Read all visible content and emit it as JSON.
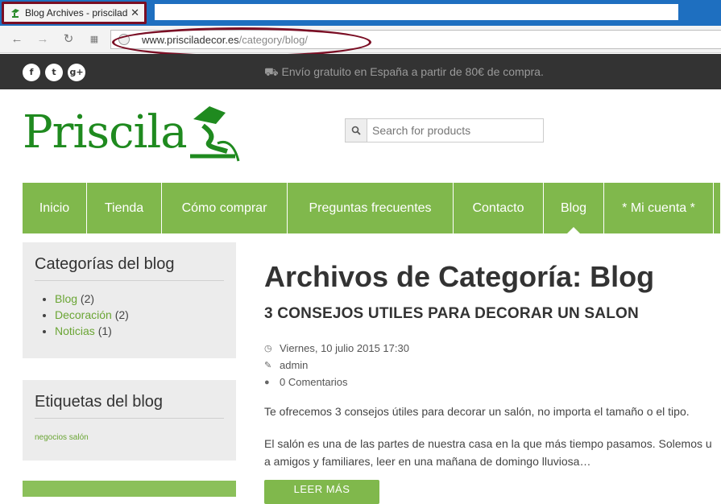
{
  "browser": {
    "tab_title": "Blog Archives - prisciladi",
    "close_glyph": "✕",
    "url_domain": "www.prisciladecor.es",
    "url_path": "/category/blog/"
  },
  "topbar": {
    "social": [
      "f",
      "t",
      "g+"
    ],
    "shipping": "Envío gratuito en España a partir de 80€ de compra."
  },
  "header": {
    "logo": "Priscila",
    "search_placeholder": "Search for products"
  },
  "menu": [
    {
      "label": "Inicio",
      "width": 80
    },
    {
      "label": "Tienda",
      "width": 93
    },
    {
      "label": "Cómo comprar",
      "width": 156
    },
    {
      "label": "Preguntas frecuentes",
      "width": 206
    },
    {
      "label": "Contacto",
      "width": 112
    },
    {
      "label": "Blog",
      "width": 75,
      "active": true
    },
    {
      "label": "* Mi cuenta *",
      "width": 136
    },
    {
      "label": "",
      "width": 9
    }
  ],
  "sidebar": {
    "categories_title": "Categorías del blog",
    "categories": [
      {
        "name": "Blog",
        "count": "(2)"
      },
      {
        "name": "Decoración",
        "count": "(2)"
      },
      {
        "name": "Noticias",
        "count": "(1)"
      }
    ],
    "tags_title": "Etiquetas del blog",
    "tag": "negocios salón"
  },
  "main": {
    "archive_title": "Archivos de Categoría: Blog",
    "post_title": "3 CONSEJOS UTILES PARA DECORAR UN SALON",
    "date": "Viernes, 10 julio 2015 17:30",
    "author": "admin",
    "comments": "0 Comentarios",
    "p1": "Te ofrecemos 3 consejos útiles para decorar un salón, no importa el tamaño o el tipo.",
    "p2_line1": "El salón es una de las partes de nuestra casa en la que más tiempo pasamos. Solemos u",
    "p2_line2": "a amigos y familiares, leer en una mañana de domingo lluviosa…",
    "read_more": "LEER MÁS"
  },
  "colors": {
    "brand_green": "#80b84c",
    "logo_green": "#1f8a1f",
    "annotation": "#7a0e24"
  }
}
